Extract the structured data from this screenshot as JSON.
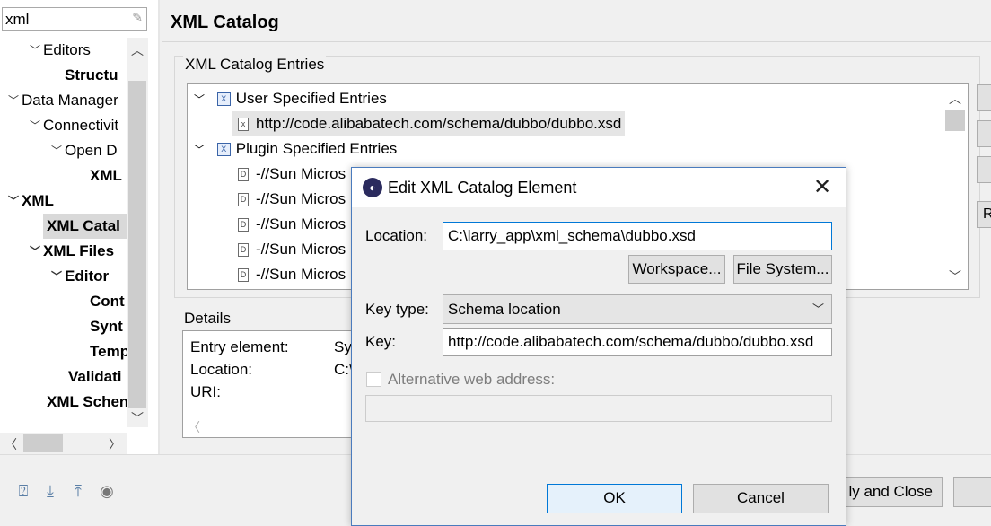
{
  "nav": {
    "filter_value": "xml",
    "tree": [
      {
        "label": "Editors",
        "toggle": "expanded"
      },
      {
        "label": "Structu",
        "toggle": "none"
      },
      {
        "label": "Data Manager",
        "toggle": "expanded"
      },
      {
        "label": "Connectivit",
        "toggle": "expanded"
      },
      {
        "label": "Open D",
        "toggle": "expanded"
      },
      {
        "label": "XML",
        "toggle": "none"
      },
      {
        "label": "XML",
        "toggle": "expanded"
      },
      {
        "label": "XML Catal",
        "toggle": "none"
      },
      {
        "label": "XML Files",
        "toggle": "expanded"
      },
      {
        "label": "Editor",
        "toggle": "expanded"
      },
      {
        "label": "Cont",
        "toggle": "none"
      },
      {
        "label": "Synt",
        "toggle": "none"
      },
      {
        "label": "Temp",
        "toggle": "none"
      },
      {
        "label": "Validati",
        "toggle": "none"
      },
      {
        "label": "XML Schen",
        "toggle": "none"
      }
    ]
  },
  "page": {
    "title": "XML Catalog",
    "entries_label": "XML Catalog Entries",
    "entries": [
      {
        "label": "User Specified Entries",
        "kind": "category",
        "toggle": "expanded"
      },
      {
        "label": "http://code.alibabatech.com/schema/dubbo/dubbo.xsd",
        "kind": "xsd",
        "selected": true
      },
      {
        "label": "Plugin Specified Entries",
        "kind": "category",
        "toggle": "expanded"
      },
      {
        "label": "-//Sun Micros",
        "kind": "dtd"
      },
      {
        "label": "-//Sun Micros",
        "kind": "dtd"
      },
      {
        "label": "-//Sun Micros",
        "kind": "dtd"
      },
      {
        "label": "-//Sun Micros",
        "kind": "dtd"
      },
      {
        "label": "-//Sun Micros",
        "kind": "dtd"
      }
    ],
    "side_button_partial": "R",
    "details_label": "Details",
    "details": [
      {
        "key": "Entry element:",
        "value": "Sy"
      },
      {
        "key": "Location:",
        "value": "C:\\"
      },
      {
        "key": "URI:",
        "value": ""
      }
    ],
    "apply_close_label": "ly and Close"
  },
  "bottom_icons": [
    "help-icon",
    "import-icon",
    "export-icon",
    "record-icon"
  ],
  "dialog": {
    "title": "Edit XML Catalog Element",
    "location_label": "Location:",
    "location_value": "C:\\larry_app\\xml_schema\\dubbo.xsd",
    "workspace_button": "Workspace...",
    "filesystem_button": "File System...",
    "key_type_label": "Key type:",
    "key_type_value": "Schema location",
    "key_label": "Key:",
    "key_value": "http://code.alibabatech.com/schema/dubbo/dubbo.xsd",
    "alt_web_label": "Alternative web address:",
    "alt_web_value": "",
    "ok_button": "OK",
    "cancel_button": "Cancel"
  },
  "colors": {
    "accent": "#0078d7",
    "dialog_border": "#4a7bbd",
    "background": "#f0f0f0"
  }
}
